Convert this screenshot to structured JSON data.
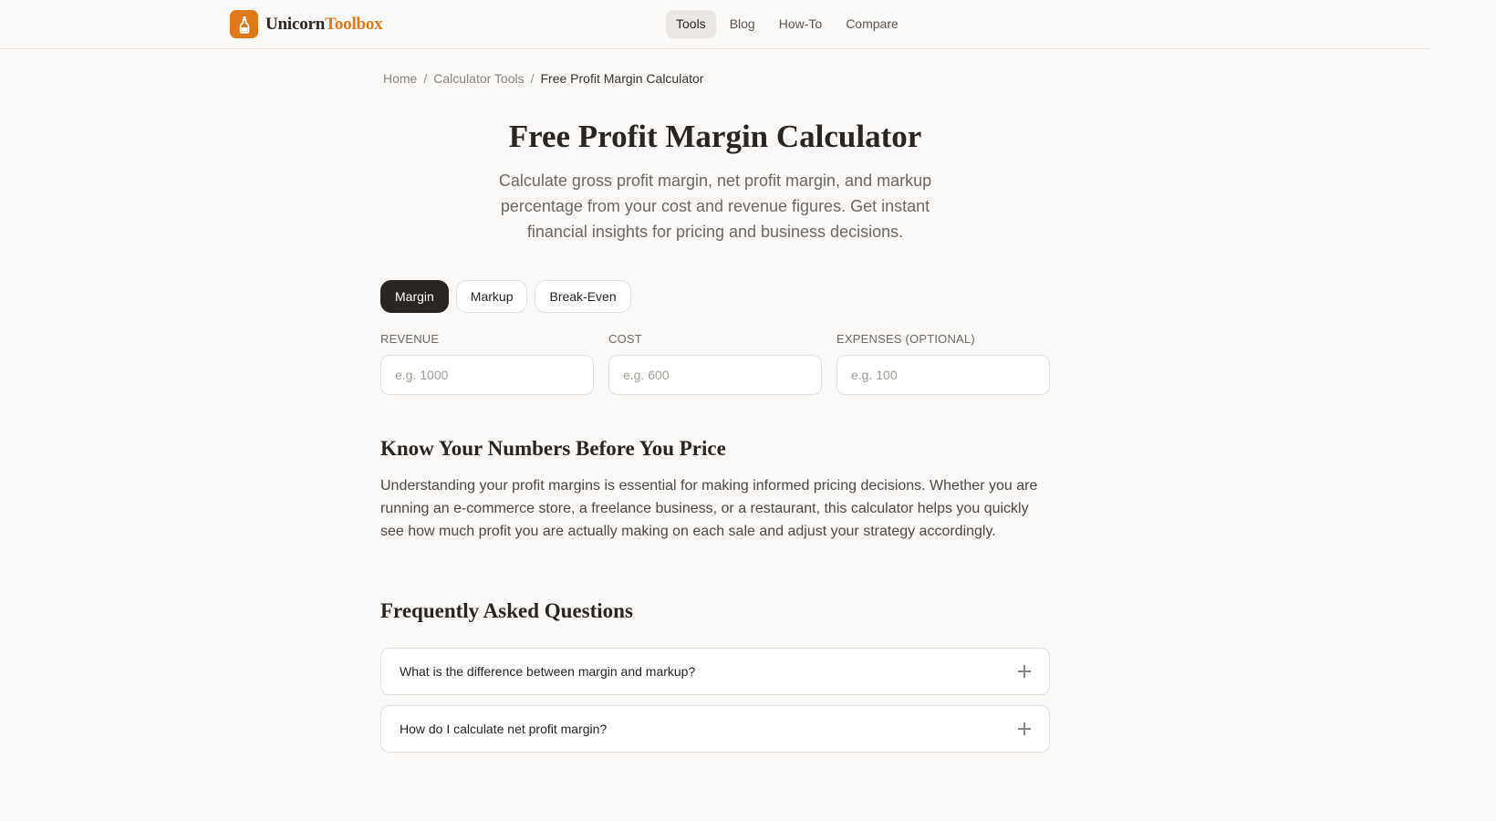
{
  "brand": {
    "name_part1": "Unicorn",
    "name_part2": "Toolbox",
    "accent_color": "#de7a1a",
    "logo_icon": "bottle-icon"
  },
  "nav": {
    "items": [
      {
        "label": "Tools",
        "active": true
      },
      {
        "label": "Blog"
      },
      {
        "label": "How-To"
      },
      {
        "label": "Compare"
      }
    ]
  },
  "breadcrumb": {
    "items": [
      "Home",
      "Calculator Tools",
      "Free Profit Margin Calculator"
    ],
    "separator": "/"
  },
  "page": {
    "title": "Free Profit Margin Calculator",
    "subtitle": "Calculate gross profit margin, net profit margin, and markup percentage from your cost and revenue figures. Get instant financial insights for pricing and business decisions."
  },
  "calculator": {
    "tabs": [
      {
        "label": "Margin",
        "active": true
      },
      {
        "label": "Markup"
      },
      {
        "label": "Break-Even"
      }
    ],
    "fields": [
      {
        "label": "REVENUE",
        "placeholder": "e.g. 1000",
        "value": ""
      },
      {
        "label": "COST",
        "placeholder": "e.g. 600",
        "value": ""
      },
      {
        "label": "EXPENSES (OPTIONAL)",
        "placeholder": "e.g. 100",
        "value": ""
      }
    ]
  },
  "content": {
    "heading": "Know Your Numbers Before You Price",
    "paragraph": "Understanding your profit margins is essential for making informed pricing decisions. Whether you are running an e-commerce store, a freelance business, or a restaurant, this calculator helps you quickly see how much profit you are actually making on each sale and adjust your strategy accordingly."
  },
  "faq": {
    "heading": "Frequently Asked Questions",
    "items": [
      {
        "question": "What is the difference between margin and markup?",
        "icon": "plus-icon"
      },
      {
        "question": "How do I calculate net profit margin?",
        "icon": "plus-icon"
      }
    ]
  }
}
